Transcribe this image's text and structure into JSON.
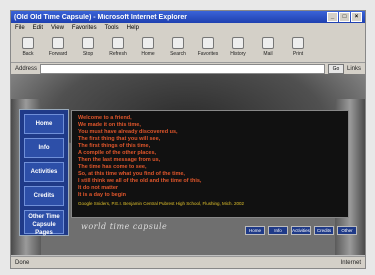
{
  "window": {
    "title": "(Old Old Time Capsule) - Microsoft Internet Explorer"
  },
  "menu": [
    "File",
    "Edit",
    "View",
    "Favorites",
    "Tools",
    "Help"
  ],
  "toolbar": [
    "Back",
    "Forward",
    "Stop",
    "Refresh",
    "Home",
    "Search",
    "Favorites",
    "History",
    "Mail",
    "Print"
  ],
  "address": {
    "label": "Address",
    "value": "",
    "go": "Go",
    "links": "Links"
  },
  "nav": [
    {
      "label": "Home"
    },
    {
      "label": "Info"
    },
    {
      "label": "Activities"
    },
    {
      "label": "Credits"
    },
    {
      "label": "Other Time Capsule Pages"
    }
  ],
  "content": {
    "lines": [
      "Welcome to a friend,",
      "We made it on this time,",
      "You must have already discovered us,",
      "The first thing that you will see,",
      "The first things of this time,",
      "A compile of the other places,",
      "Then the last message from us,",
      "The time has come to see,",
      "So, at this time what you find of the time,",
      "I still think we all of the old and the time of this,",
      "It do not matter",
      "It is a day to begin"
    ],
    "credit": "Google Sniders, P.E.I. Benjamin Central Pubrest High School, Flushing, Mich. 2002"
  },
  "footer": {
    "title": "world time capsule"
  },
  "pager": [
    "Home",
    "Info",
    "Activities",
    "Credits",
    "Other"
  ],
  "status": {
    "left": "Done",
    "right": "Internet"
  }
}
